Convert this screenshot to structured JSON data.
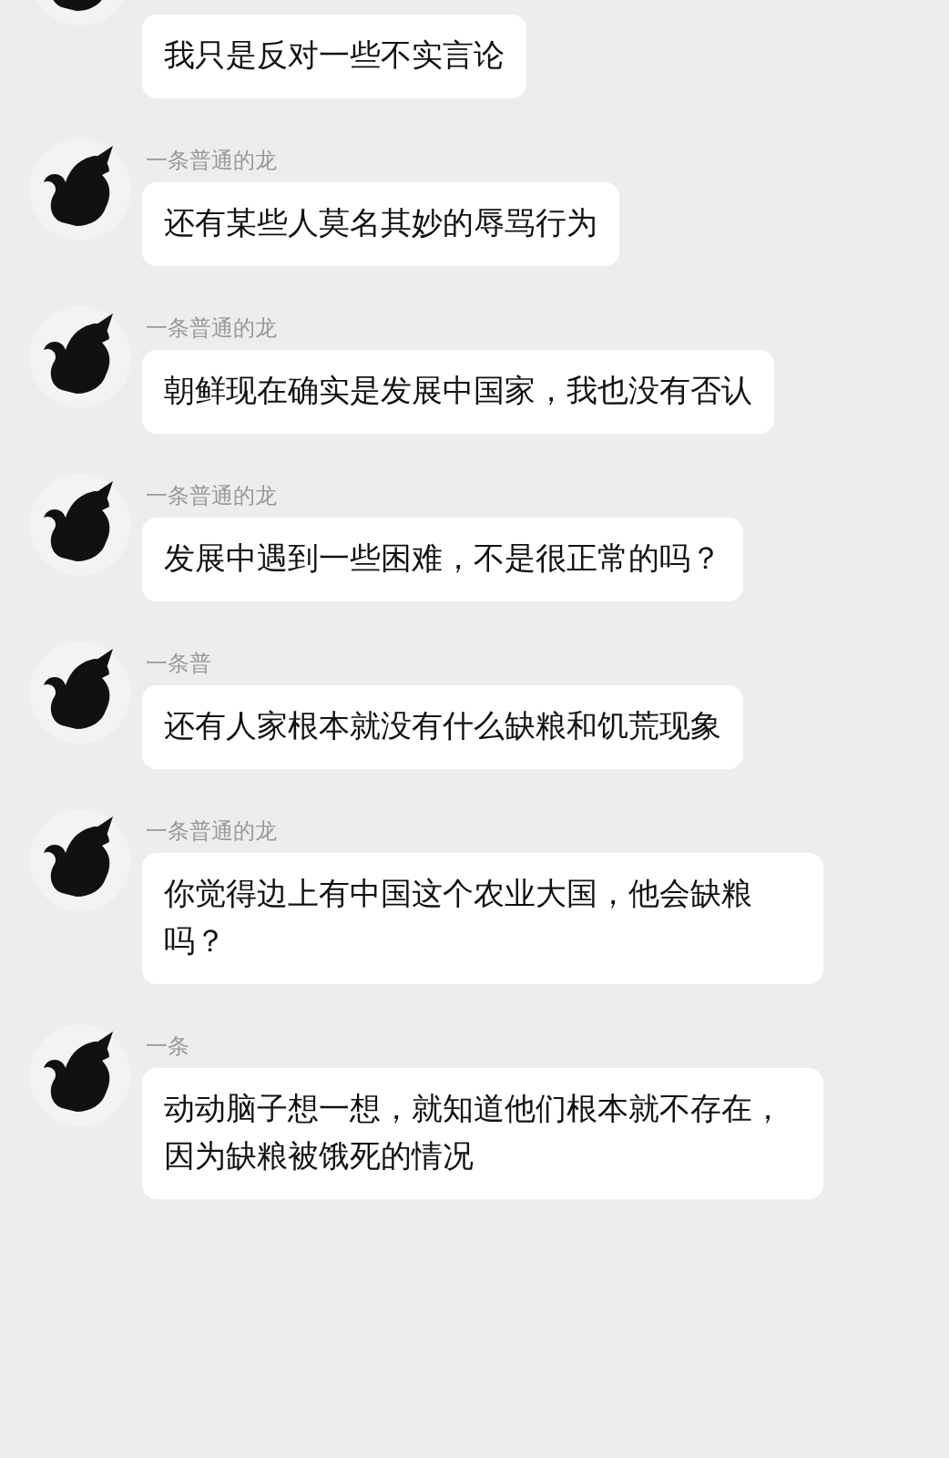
{
  "messages": [
    {
      "text": "我只是反对一些不实言论"
    },
    {
      "sender": "一条普通的龙",
      "text": "还有某些人莫名其妙的辱骂行为"
    },
    {
      "sender": "一条普通的龙",
      "text": "朝鲜现在确实是发展中国家，我也没有否认"
    },
    {
      "sender": "一条普通的龙",
      "text": "发展中遇到一些困难，不是很正常的吗？"
    },
    {
      "sender": "一条普",
      "text": "还有人家根本就没有什么缺粮和饥荒现象"
    },
    {
      "sender": "一条普通的龙",
      "text": "你觉得边上有中国这个农业大国，他会缺粮吗？"
    },
    {
      "sender": "一条",
      "text": "动动脑子想一想，就知道他们根本就不存在，因为缺粮被饿死的情况"
    }
  ]
}
